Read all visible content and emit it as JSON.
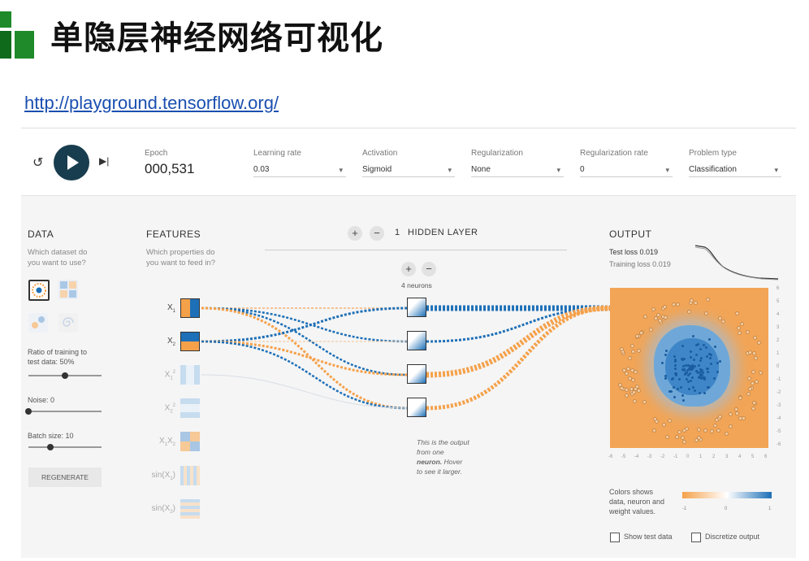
{
  "slide": {
    "title": "单隐层神经网络可视化",
    "url": "http://playground.tensorflow.org/"
  },
  "toolbar": {
    "epoch_label": "Epoch",
    "epoch_value": "000,531",
    "controls": [
      {
        "label": "Learning rate",
        "value": "0.03"
      },
      {
        "label": "Activation",
        "value": "Sigmoid"
      },
      {
        "label": "Regularization",
        "value": "None"
      },
      {
        "label": "Regularization rate",
        "value": "0"
      },
      {
        "label": "Problem type",
        "value": "Classification"
      }
    ]
  },
  "data_panel": {
    "title": "DATA",
    "subtitle_1": "Which dataset do",
    "subtitle_2": "you want to use?",
    "ratio_label_1": "Ratio of training to",
    "ratio_label_2": "test data:  50%",
    "noise_label": "Noise:  0",
    "batch_label": "Batch size:  10",
    "regenerate": "REGENERATE",
    "ratio_value": 0.5,
    "noise_value": 0,
    "batch_value": 0.3
  },
  "features_panel": {
    "title": "FEATURES",
    "subtitle_1": "Which properties do",
    "subtitle_2": "you want to feed in?",
    "features": [
      {
        "base": "X",
        "sub": "1",
        "sup": "",
        "active": true
      },
      {
        "base": "X",
        "sub": "2",
        "sup": "",
        "active": true
      },
      {
        "base": "X",
        "sub": "1",
        "sup": "2",
        "active": false
      },
      {
        "base": "X",
        "sub": "2",
        "sup": "2",
        "active": false
      },
      {
        "base": "X",
        "sub": "1",
        "sup": "",
        "active": false
      },
      {
        "base": "sin(X",
        "sub": "1",
        "sup": "",
        "active": false
      },
      {
        "base": "sin(X",
        "sub": "2",
        "sup": "",
        "active": false
      }
    ]
  },
  "network": {
    "add_symbol": "+",
    "remove_symbol": "−",
    "layer_count": "1",
    "layer_label": "HIDDEN LAYER",
    "neurons_label": "4 neurons",
    "note_1": "This is the output",
    "note_2": "from one",
    "note_3": "neuron.",
    "note_4": " Hover",
    "note_5": "to see it larger."
  },
  "output_panel": {
    "title": "OUTPUT",
    "test_loss": "Test loss 0.019",
    "training_loss": "Training loss 0.019",
    "y_ticks": [
      "6",
      "5",
      "4",
      "3",
      "2",
      "1",
      "0",
      "-1",
      "-2",
      "-3",
      "-4",
      "-5",
      "-6"
    ],
    "x_ticks": [
      "-6",
      "-5",
      "-4",
      "-3",
      "-2",
      "-1",
      "0",
      "1",
      "2",
      "3",
      "4",
      "5",
      "6"
    ],
    "legend_1": "Colors shows",
    "legend_2": "data, neuron and",
    "legend_3": "weight values.",
    "scale_min": "-1",
    "scale_mid": "0",
    "scale_max": "1",
    "show_test": "Show test data",
    "discretize": "Discretize output"
  },
  "colors": {
    "positive": "#1d6fb7",
    "negative": "#f5a14a",
    "play": "#183d4e"
  },
  "icons": {
    "reset": "reset-icon",
    "play": "play-icon",
    "step": "step-forward-icon"
  }
}
